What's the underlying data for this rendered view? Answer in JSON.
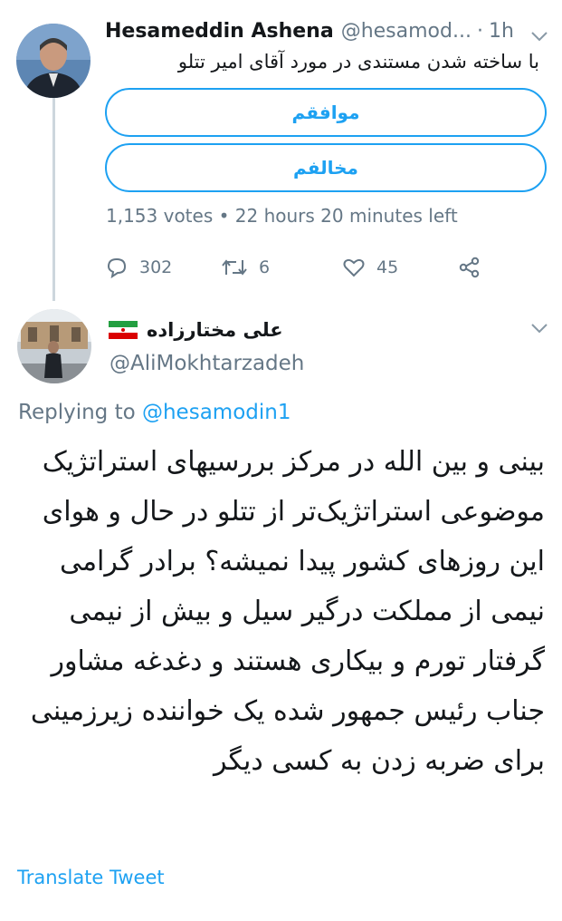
{
  "tweet1": {
    "author_name": "Hesameddin Ashena",
    "author_handle": "@hesamod...",
    "separator": "·",
    "time": "1h",
    "text": "با ساخته شدن مستندی در مورد آقای امیر تتلو",
    "poll": {
      "options": [
        "موافقم",
        "مخالفم"
      ],
      "meta": "1,153 votes • 22 hours 20 minutes left"
    },
    "actions": {
      "replies": "302",
      "retweets": "6",
      "likes": "45"
    }
  },
  "tweet2": {
    "author_name": "علی مختارزاده",
    "author_handle": "@AliMokhtarzadeh",
    "replying_prefix": "Replying to ",
    "replying_mention": "@hesamodin1",
    "text": "بینی و بین الله در مرکز بررسیهای استراتژیک موضوعی استراتژیک‌تر از تتلو در حال و هوای این روزهای کشور پیدا نمیشه؟ برادر گرامی نیمی از مملکت درگیر سیل و بیش از نیمی گرفتار تورم و بیکاری هستند و دغدغه مشاور جناب رئیس جمهور شده یک خواننده زیرزمینی برای ضربه زدن به کسی دیگر",
    "translate_label": "Translate Tweet"
  },
  "colors": {
    "accent": "#1da1f2",
    "secondary_text": "#657786",
    "thread_line": "#cdd6dd"
  }
}
